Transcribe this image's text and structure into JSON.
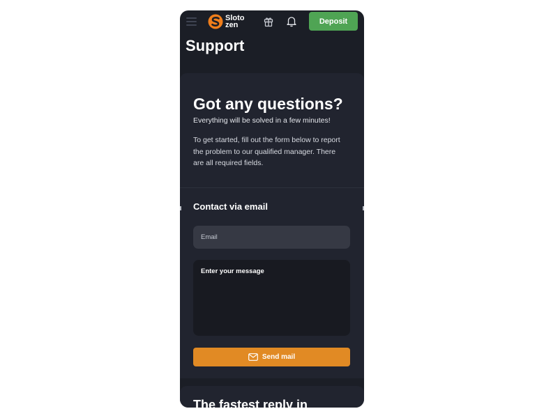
{
  "header": {
    "logo_line1": "Sloto",
    "logo_line2": "zen",
    "deposit_label": "Deposit",
    "icons": [
      "menu-icon",
      "gift-icon",
      "bell-icon"
    ]
  },
  "page": {
    "title": "Support"
  },
  "questions_card": {
    "title": "Got any questions?",
    "subtitle": "Everything will be solved in a few minutes!",
    "description": "To get started, fill out the form below to report the problem to our qualified manager. There are all required fields."
  },
  "contact": {
    "title": "Contact via email",
    "email_placeholder": "Email",
    "message_placeholder": "Enter your message",
    "send_label": "Send mail"
  },
  "next_card": {
    "title": "The fastest reply in"
  },
  "colors": {
    "background": "#1b1e26",
    "card": "#21242f",
    "deposit": "#4fa454",
    "send": "#e18a24",
    "logo_accent": "#f07e1b"
  }
}
